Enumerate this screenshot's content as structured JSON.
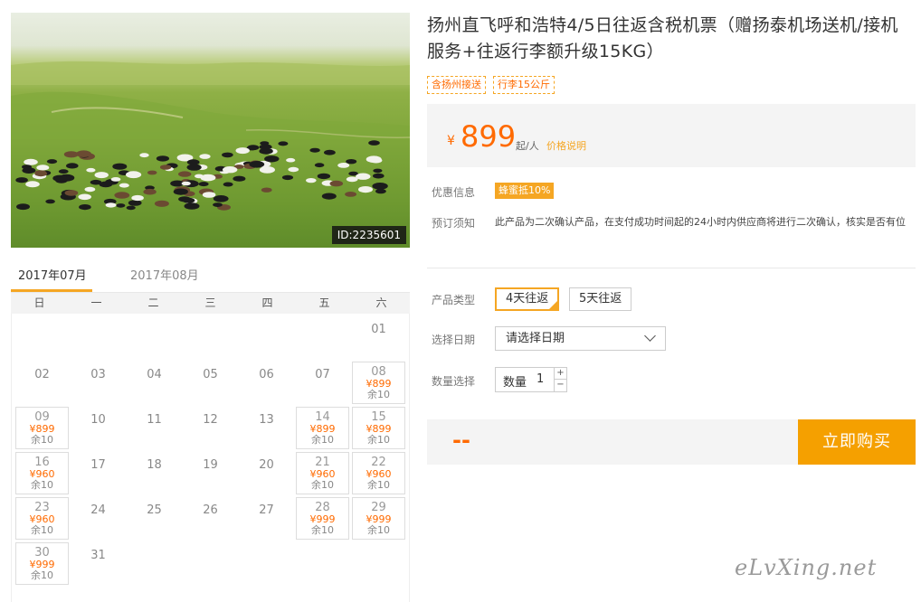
{
  "photo": {
    "id_label": "ID:2235601"
  },
  "calendar": {
    "months": [
      "2017年07月",
      "2017年08月"
    ],
    "weekdays": [
      "日",
      "一",
      "二",
      "三",
      "四",
      "五",
      "六"
    ],
    "rows": [
      [
        null,
        null,
        null,
        null,
        null,
        null,
        {
          "d": "01"
        }
      ],
      [
        {
          "d": "02"
        },
        {
          "d": "03"
        },
        {
          "d": "04"
        },
        {
          "d": "05"
        },
        {
          "d": "06"
        },
        {
          "d": "07"
        },
        {
          "d": "08",
          "price": "¥899",
          "stock": "余10"
        }
      ],
      [
        {
          "d": "09",
          "price": "¥899",
          "stock": "余10"
        },
        {
          "d": "10"
        },
        {
          "d": "11"
        },
        {
          "d": "12"
        },
        {
          "d": "13"
        },
        {
          "d": "14",
          "price": "¥899",
          "stock": "余10"
        },
        {
          "d": "15",
          "price": "¥899",
          "stock": "余10"
        }
      ],
      [
        {
          "d": "16",
          "price": "¥960",
          "stock": "余10"
        },
        {
          "d": "17"
        },
        {
          "d": "18"
        },
        {
          "d": "19"
        },
        {
          "d": "20"
        },
        {
          "d": "21",
          "price": "¥960",
          "stock": "余10"
        },
        {
          "d": "22",
          "price": "¥960",
          "stock": "余10"
        }
      ],
      [
        {
          "d": "23",
          "price": "¥960",
          "stock": "余10"
        },
        {
          "d": "24"
        },
        {
          "d": "25"
        },
        {
          "d": "26"
        },
        {
          "d": "27"
        },
        {
          "d": "28",
          "price": "¥999",
          "stock": "余10"
        },
        {
          "d": "29",
          "price": "¥999",
          "stock": "余10"
        }
      ],
      [
        {
          "d": "30",
          "price": "¥999",
          "stock": "余10"
        },
        {
          "d": "31"
        },
        null,
        null,
        null,
        null,
        null
      ]
    ]
  },
  "product": {
    "title": "扬州直飞呼和浩特4/5日往返含税机票（赠扬泰机场送机/接机服务+往返行李额升级15KG）",
    "tags": [
      "含扬州接送",
      "行李15公斤"
    ],
    "price": {
      "currency": "¥",
      "amount": "899",
      "unit": "起/人",
      "explain_link": "价格说明"
    },
    "promo_label": "优惠信息",
    "promo_badge": "蜂蜜抵10%",
    "notice_label": "预订须知",
    "notice_text": "此产品为二次确认产品，在支付成功时间起的24小时内供应商将进行二次确认，核实是否有位",
    "type_label": "产品类型",
    "types": [
      "4天往返",
      "5天往返"
    ],
    "selected_type": 0,
    "date_label": "选择日期",
    "date_placeholder": "请选择日期",
    "qty_label_row": "数量选择",
    "qty_label": "数量",
    "qty_value": "1",
    "qty_plus": "+",
    "qty_minus": "−",
    "total_display": "--",
    "buy_label": "立即购买"
  },
  "watermark": "eLvXing.net",
  "colors": {
    "accent": "#f5a623",
    "price": "#ff6a00",
    "buy": "#f5a000"
  }
}
